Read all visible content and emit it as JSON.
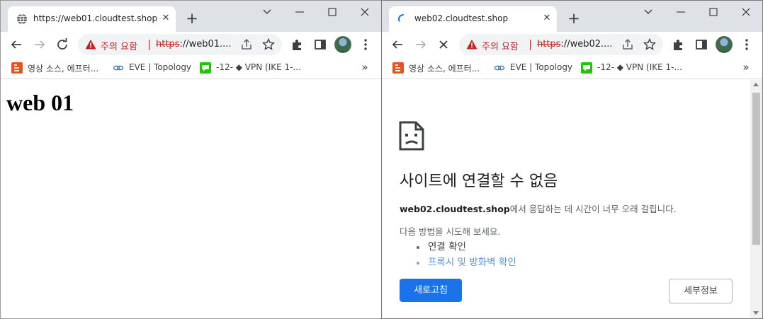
{
  "window1": {
    "tab": {
      "title": "https://web01.cloudtest.shop",
      "close_glyph": "✕",
      "icon": "globe-icon"
    },
    "new_tab_glyph": "+",
    "address": {
      "warning": "주의 요함",
      "scheme": "https",
      "url_rest": "://web01...."
    },
    "bookmarks": [
      {
        "label": "영상 소스, 에프터...",
        "icon": "blogger-icon"
      },
      {
        "label": "EVE | Topology",
        "icon": "eve-link-icon"
      },
      {
        "label": "-12- ◆ VPN (IKE 1-...",
        "icon": "chat-icon"
      }
    ],
    "bookmarks_more": "»",
    "content": {
      "heading": "web 01"
    }
  },
  "window2": {
    "tab": {
      "title": "web02.cloudtest.shop",
      "close_glyph": "✕",
      "icon": "loading-spinner-icon"
    },
    "new_tab_glyph": "+",
    "address": {
      "warning": "주의 요함",
      "scheme": "https",
      "url_rest": "://web02...."
    },
    "bookmarks": [
      {
        "label": "영상 소스, 에프터...",
        "icon": "blogger-icon"
      },
      {
        "label": "EVE | Topology",
        "icon": "eve-link-icon"
      },
      {
        "label": "-12- ◆ VPN (IKE 1-...",
        "icon": "chat-icon"
      }
    ],
    "bookmarks_more": "»",
    "error": {
      "icon": "sad-page-icon",
      "title": "사이트에 연결할 수 없음",
      "host": "web02.cloudtest.shop",
      "desc_suffix": "에서 응답하는 데 시간이 너무 오래 걸립니다.",
      "try_label": "다음 방법을 시도해 보세요.",
      "suggestions": [
        "연결 확인",
        "프록시 및 방화벽 확인"
      ],
      "reload_button": "새로고침",
      "details_button": "세부정보"
    }
  },
  "colors": {
    "tabstrip": "#dee1e6",
    "warning": "#c5221f",
    "primary_button": "#1a73e8",
    "link": "#5b95d6"
  }
}
